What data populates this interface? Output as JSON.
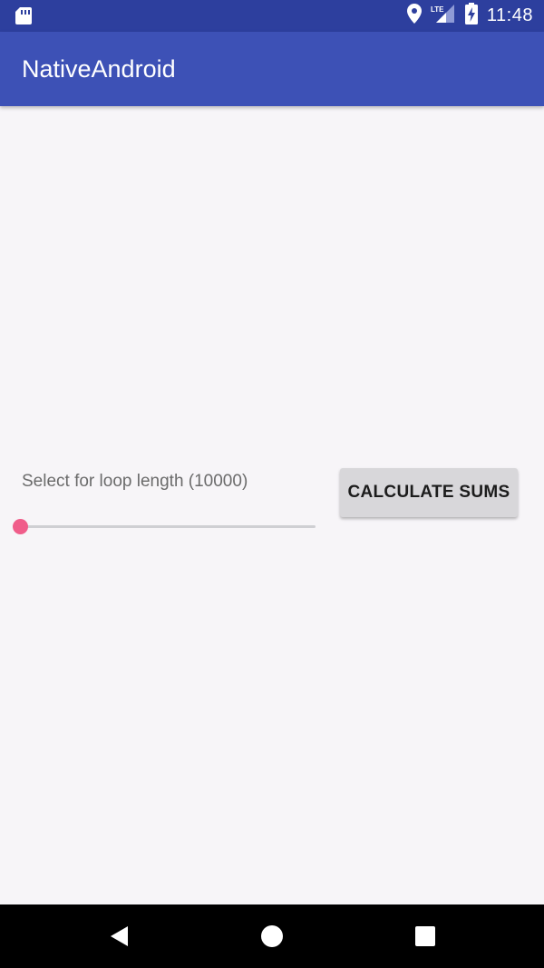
{
  "status_bar": {
    "time": "11:48",
    "network_label": "LTE",
    "icons": [
      "sd-card-icon",
      "location-icon",
      "lte-signal-icon",
      "battery-charging-icon"
    ]
  },
  "app_bar": {
    "title": "NativeAndroid"
  },
  "main": {
    "loop_label": "Select for loop length (10000)",
    "slider": {
      "value_fraction": 0.0
    },
    "calculate_button_label": "CALCULATE SUMS"
  },
  "nav_bar": {
    "icons": [
      "back-icon",
      "home-icon",
      "recents-icon"
    ]
  },
  "colors": {
    "status_bar": "#2D3F9E",
    "app_bar": "#3D51B6",
    "background": "#F7F5F8",
    "accent": "#F05D8A",
    "button": "#D8D7DA"
  }
}
